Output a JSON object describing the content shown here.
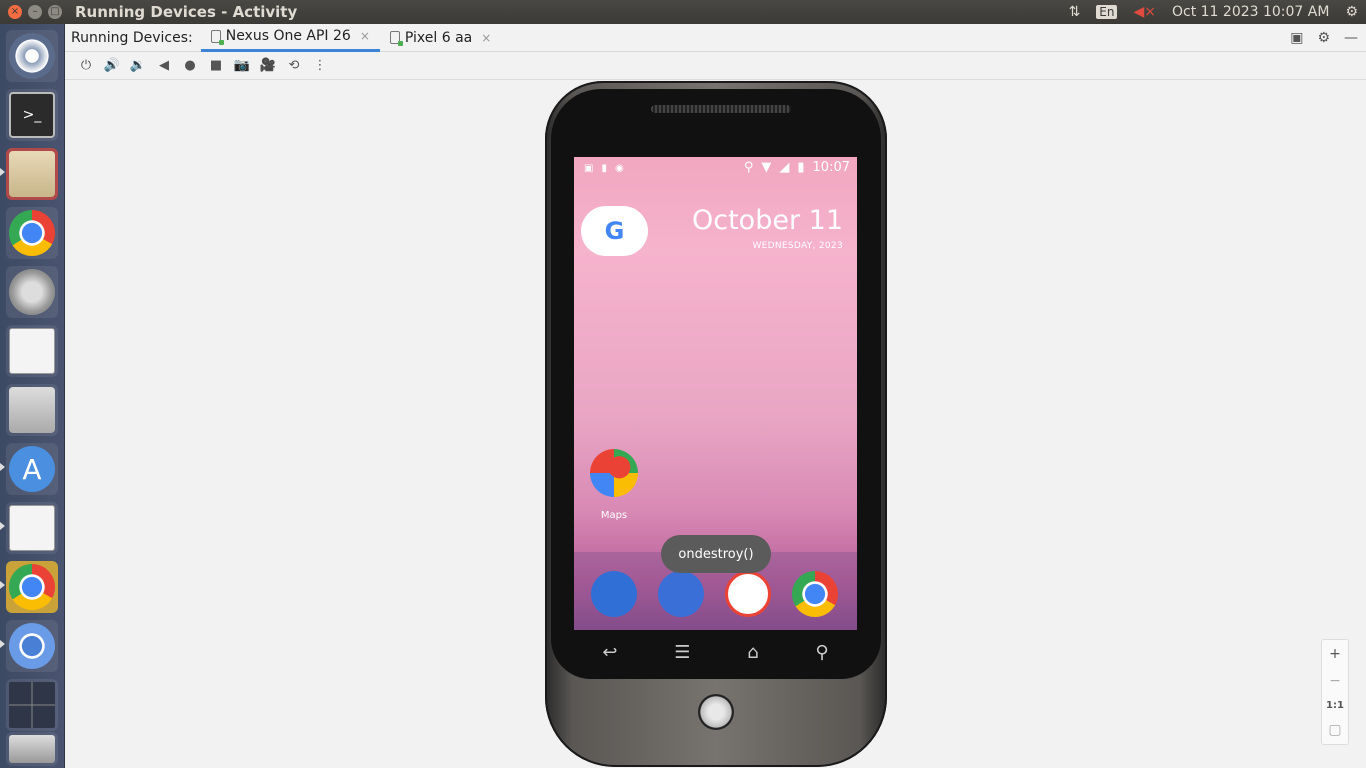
{
  "window": {
    "title": "Running Devices - Activity"
  },
  "tray": {
    "language": "En",
    "datetime": "Oct 11 2023 10:07 AM"
  },
  "launcher": {
    "items": [
      "ubuntu-dash",
      "terminal",
      "files",
      "chrome",
      "system-settings",
      "text-editor",
      "screenshot",
      "android-studio",
      "text-editor-2",
      "chrome-2",
      "chromium",
      "workspace-switcher",
      "trash"
    ]
  },
  "panel": {
    "label": "Running Devices:",
    "tabs": [
      {
        "label": "Nexus One API 26",
        "active": true
      },
      {
        "label": "Pixel 6 aa",
        "active": false
      }
    ]
  },
  "toolbar": {
    "buttons": [
      "power",
      "volume-up",
      "volume-down",
      "back",
      "home",
      "overview",
      "screenshot",
      "screen-record",
      "rotate",
      "more"
    ]
  },
  "device": {
    "status_time": "10:07",
    "date_main": "October 11",
    "date_sub": "WEDNESDAY, 2023",
    "google_letter": "G",
    "maps_label": "Maps",
    "toast": "ondestroy()",
    "dock": [
      "phone",
      "messages",
      "gmail",
      "chrome"
    ]
  },
  "zoom": {
    "plus": "+",
    "minus": "−",
    "one_to_one": "1:1"
  }
}
